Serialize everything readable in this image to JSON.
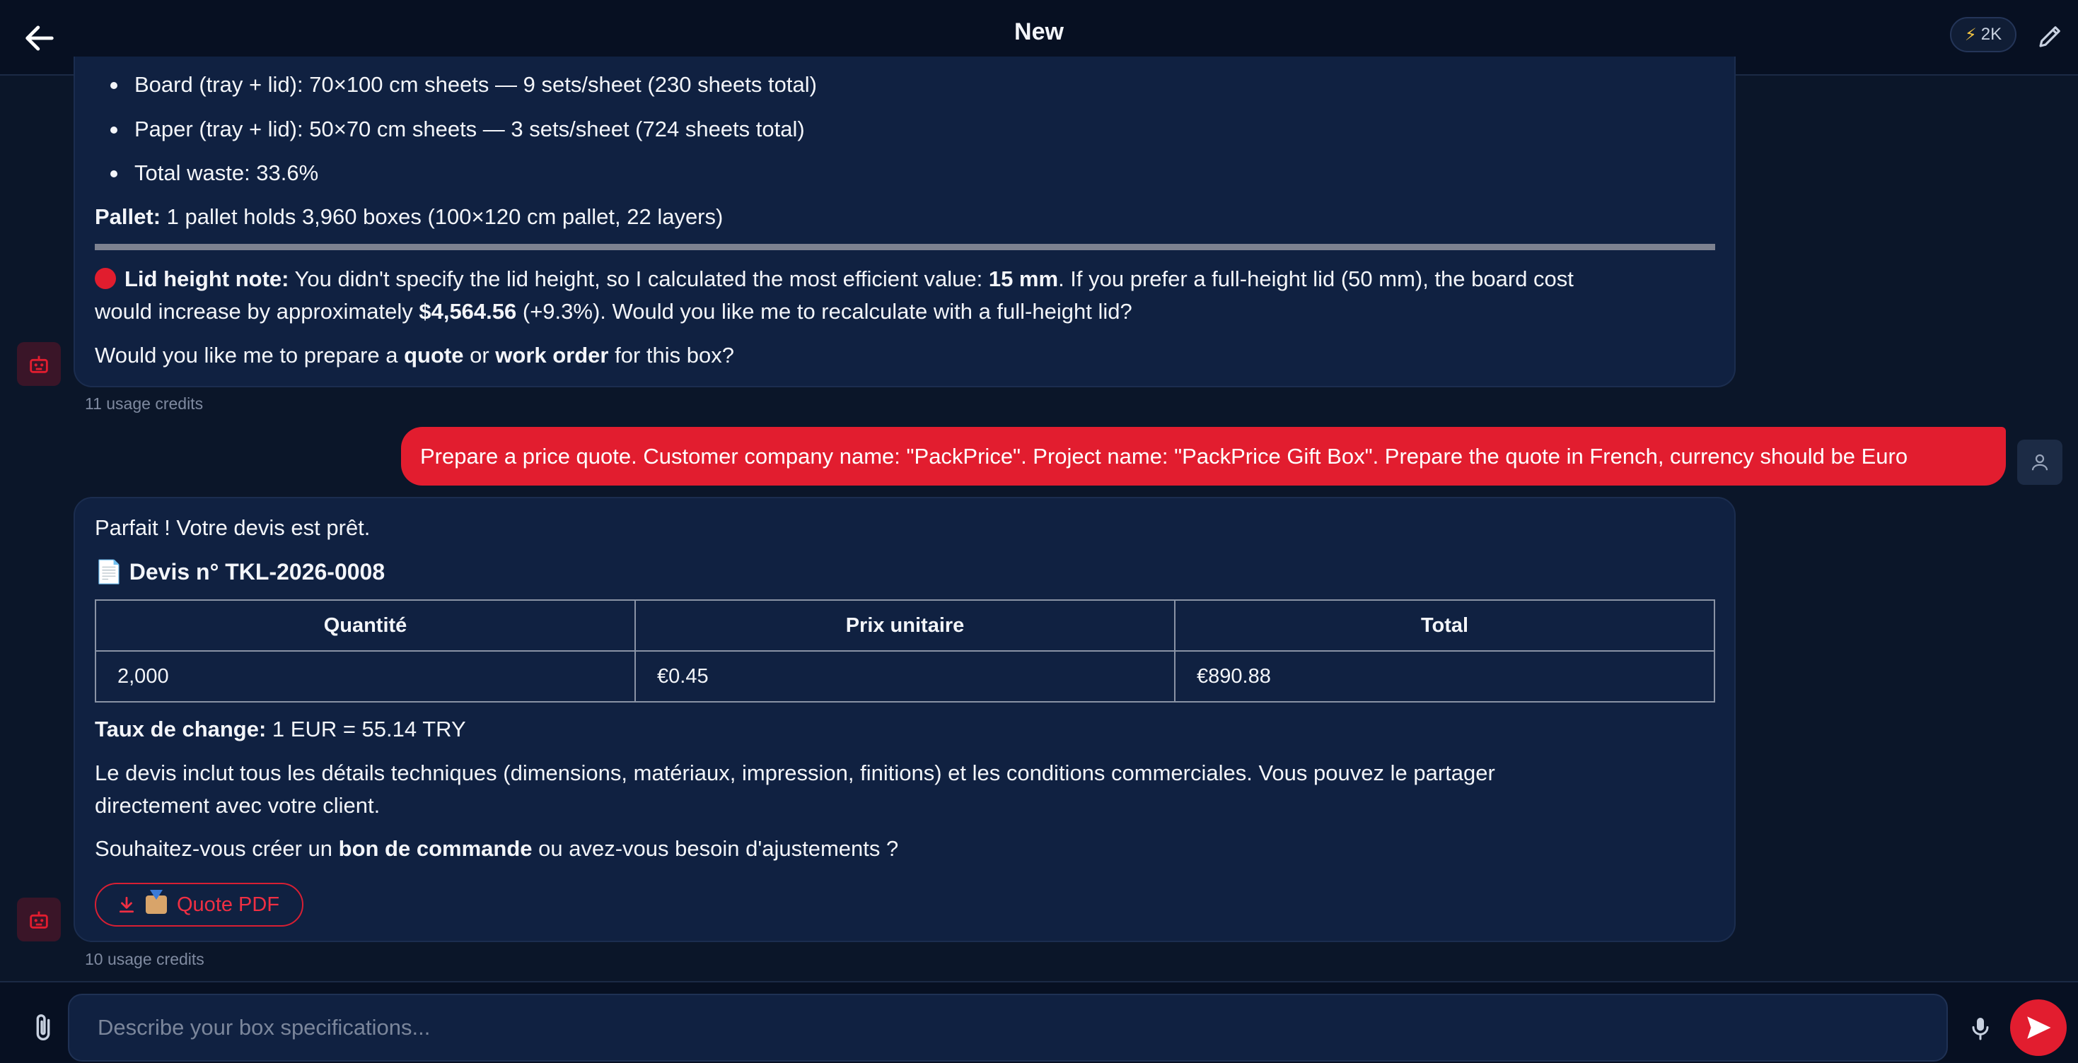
{
  "header": {
    "title": "New",
    "credits": "2K"
  },
  "messages": {
    "bot1": {
      "bullets": [
        "Board (tray + lid): 70×100 cm sheets — 9 sets/sheet (230 sheets total)",
        "Paper (tray + lid): 50×70 cm sheets — 3 sets/sheet (724 sheets total)",
        "Total waste: 33.6%"
      ],
      "pallet_label": "Pallet:",
      "pallet_text": " 1 pallet holds 3,960 boxes (100×120 cm pallet, 22 layers)",
      "note_label": "Lid height note:",
      "note_text_1": " You didn't specify the lid height, so I calculated the most efficient value: ",
      "note_value": "15 mm",
      "note_text_2": ". If you prefer a full-height lid (50 mm), the board cost",
      "note_line2_a": "would increase by approximately ",
      "note_line2_amount": "$4,564.56",
      "note_line2_b": " (+9.3%). Would you like me to recalculate with a full-height lid?",
      "question_a": "Would you like me to prepare a ",
      "question_quote": "quote",
      "question_or": " or ",
      "question_work_order": "work order",
      "question_b": " for this box?",
      "usage": "11 usage credits"
    },
    "user1": {
      "text": "Prepare a price quote. Customer company name: \"PackPrice\". Project name: \"PackPrice Gift Box\". Prepare the quote in French, currency should be Euro"
    },
    "bot2": {
      "intro": "Parfait ! Votre devis est prêt.",
      "doc_emoji": "📄",
      "quote_title": "Devis n° TKL-2026-0008",
      "table": {
        "headers": [
          "Quantité",
          "Prix unitaire",
          "Total"
        ],
        "rows": [
          [
            "2,000",
            "€0.45",
            "€890.88"
          ]
        ]
      },
      "rate_label": "Taux de change:",
      "rate_value": " 1 EUR = 55.14 TRY",
      "para_line1": "Le devis inclut tous les détails techniques (dimensions, matériaux, impression, finitions) et les conditions commerciales. Vous pouvez le partager",
      "para_line2": "directement avec votre client.",
      "ask_a": "Souhaitez-vous créer un ",
      "ask_bold": "bon de commande",
      "ask_b": " ou avez-vous besoin d'ajustements ?",
      "pdf_button": "Quote PDF",
      "usage": "10 usage credits"
    }
  },
  "composer": {
    "placeholder": "Describe your box specifications..."
  },
  "colors": {
    "background": "#0b1629",
    "bubble": "#102141",
    "accent": "#e21d2f"
  }
}
